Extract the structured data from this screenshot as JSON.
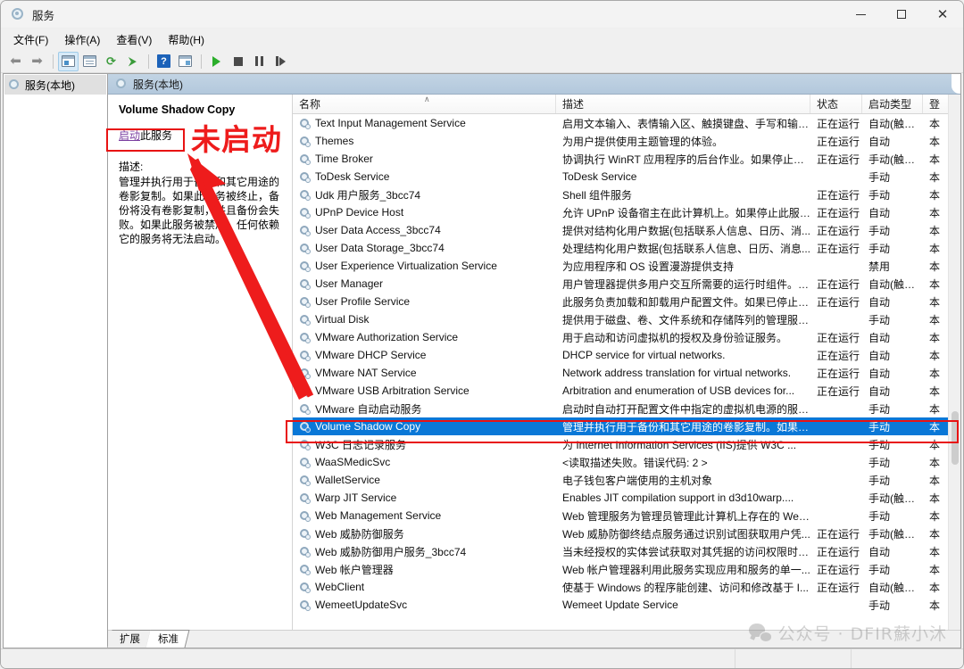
{
  "window": {
    "title": "服务",
    "icon": "services-gear-icon",
    "controls": {
      "minimize": "最小化",
      "maximize": "最大化",
      "close": "关闭"
    }
  },
  "menubar": [
    {
      "label": "文件(F)",
      "name": "menu-file"
    },
    {
      "label": "操作(A)",
      "name": "menu-action"
    },
    {
      "label": "查看(V)",
      "name": "menu-view"
    },
    {
      "label": "帮助(H)",
      "name": "menu-help"
    }
  ],
  "toolbar": [
    {
      "name": "back-button",
      "icon": "arrow-left-icon",
      "glyph": "⬅"
    },
    {
      "name": "forward-button",
      "icon": "arrow-right-icon",
      "glyph": "➡"
    },
    {
      "name": "show-hide-tree-button",
      "icon": "tree-pane-icon",
      "active": true
    },
    {
      "name": "properties-button",
      "icon": "document-properties-icon"
    },
    {
      "name": "refresh-button",
      "icon": "refresh-icon",
      "glyph": "⟳"
    },
    {
      "name": "export-list-button",
      "icon": "export-list-icon",
      "glyph": "⮞"
    },
    {
      "name": "help-button",
      "icon": "help-question-icon",
      "glyph": "?"
    },
    {
      "name": "show-action-pane-button",
      "icon": "action-pane-icon"
    },
    {
      "name": "start-service-button",
      "icon": "play-icon"
    },
    {
      "name": "stop-service-button",
      "icon": "stop-icon"
    },
    {
      "name": "pause-service-button",
      "icon": "pause-icon"
    },
    {
      "name": "restart-service-button",
      "icon": "restart-icon"
    }
  ],
  "tree": {
    "root": {
      "label": "服务(本地)",
      "icon": "services-gear-icon"
    }
  },
  "content_header": {
    "label": "服务(本地)",
    "icon": "services-gear-icon"
  },
  "detail": {
    "service_title": "Volume Shadow Copy",
    "action_link": "启动",
    "action_suffix": "此服务",
    "description_label": "描述:",
    "description_text": "管理并执行用于备份和其它用途的卷影复制。如果此服务被终止，备份将没有卷影复制，并且备份会失败。如果此服务被禁用，任何依赖它的服务将无法启动。"
  },
  "list": {
    "columns": [
      {
        "label": "名称",
        "name": "column-name",
        "sorted": true,
        "sort_glyph": "∧"
      },
      {
        "label": "描述",
        "name": "column-description"
      },
      {
        "label": "状态",
        "name": "column-status"
      },
      {
        "label": "启动类型",
        "name": "column-startup-type"
      },
      {
        "label": "登",
        "name": "column-logon-as"
      }
    ],
    "rows": [
      {
        "name": "Text Input Management Service",
        "desc": "启用文本输入、表情输入区、触摸键盘、手写和输入...",
        "status": "正在运行",
        "startup": "自动(触发...",
        "logon": "本",
        "selected": false
      },
      {
        "name": "Themes",
        "desc": "为用户提供使用主题管理的体验。",
        "status": "正在运行",
        "startup": "自动",
        "logon": "本",
        "selected": false
      },
      {
        "name": "Time Broker",
        "desc": "协调执行 WinRT 应用程序的后台作业。如果停止或...",
        "status": "正在运行",
        "startup": "手动(触发...",
        "logon": "本",
        "selected": false
      },
      {
        "name": "ToDesk Service",
        "desc": "ToDesk Service",
        "status": "",
        "startup": "手动",
        "logon": "本",
        "selected": false
      },
      {
        "name": "Udk 用户服务_3bcc74",
        "desc": "Shell 组件服务",
        "status": "正在运行",
        "startup": "手动",
        "logon": "本",
        "selected": false
      },
      {
        "name": "UPnP Device Host",
        "desc": "允许 UPnP 设备宿主在此计算机上。如果停止此服务...",
        "status": "正在运行",
        "startup": "自动",
        "logon": "本",
        "selected": false
      },
      {
        "name": "User Data Access_3bcc74",
        "desc": "提供对结构化用户数据(包括联系人信息、日历、消...",
        "status": "正在运行",
        "startup": "手动",
        "logon": "本",
        "selected": false
      },
      {
        "name": "User Data Storage_3bcc74",
        "desc": "处理结构化用户数据(包括联系人信息、日历、消息...",
        "status": "正在运行",
        "startup": "手动",
        "logon": "本",
        "selected": false
      },
      {
        "name": "User Experience Virtualization Service",
        "desc": "为应用程序和 OS 设置漫游提供支持",
        "status": "",
        "startup": "禁用",
        "logon": "本",
        "selected": false
      },
      {
        "name": "User Manager",
        "desc": "用户管理器提供多用户交互所需要的运行时组件。如...",
        "status": "正在运行",
        "startup": "自动(触发...",
        "logon": "本",
        "selected": false
      },
      {
        "name": "User Profile Service",
        "desc": "此服务负责加载和卸载用户配置文件。如果已停止或...",
        "status": "正在运行",
        "startup": "自动",
        "logon": "本",
        "selected": false
      },
      {
        "name": "Virtual Disk",
        "desc": "提供用于磁盘、卷、文件系统和存储阵列的管理服务...",
        "status": "",
        "startup": "手动",
        "logon": "本",
        "selected": false
      },
      {
        "name": "VMware Authorization Service",
        "desc": "用于启动和访问虚拟机的授权及身份验证服务。",
        "status": "正在运行",
        "startup": "自动",
        "logon": "本",
        "selected": false
      },
      {
        "name": "VMware DHCP Service",
        "desc": "DHCP service for virtual networks.",
        "status": "正在运行",
        "startup": "自动",
        "logon": "本",
        "selected": false
      },
      {
        "name": "VMware NAT Service",
        "desc": "Network address translation for virtual networks.",
        "status": "正在运行",
        "startup": "自动",
        "logon": "本",
        "selected": false
      },
      {
        "name": "VMware USB Arbitration Service",
        "desc": "Arbitration and enumeration of USB devices for...",
        "status": "正在运行",
        "startup": "自动",
        "logon": "本",
        "selected": false
      },
      {
        "name": "VMware 自动启动服务",
        "desc": "启动时自动打开配置文件中指定的虚拟机电源的服务...",
        "status": "",
        "startup": "手动",
        "logon": "本",
        "selected": false
      },
      {
        "name": "Volume Shadow Copy",
        "desc": "管理并执行用于备份和其它用途的卷影复制。如果此...",
        "status": "",
        "startup": "手动",
        "logon": "本",
        "selected": true
      },
      {
        "name": "W3C 日志记录服务",
        "desc": "为 Internet Information Services (IIS)提供 W3C ...",
        "status": "",
        "startup": "手动",
        "logon": "本",
        "selected": false
      },
      {
        "name": "WaaSMedicSvc",
        "desc": "<读取描述失败。错误代码: 2 >",
        "status": "",
        "startup": "手动",
        "logon": "本",
        "selected": false
      },
      {
        "name": "WalletService",
        "desc": "电子钱包客户端使用的主机对象",
        "status": "",
        "startup": "手动",
        "logon": "本",
        "selected": false
      },
      {
        "name": "Warp JIT Service",
        "desc": "Enables JIT compilation support in d3d10warp....",
        "status": "",
        "startup": "手动(触发...",
        "logon": "本",
        "selected": false
      },
      {
        "name": "Web Management Service",
        "desc": "Web 管理服务为管理员管理此计算机上存在的 Web...",
        "status": "",
        "startup": "手动",
        "logon": "本",
        "selected": false
      },
      {
        "name": "Web 威胁防御服务",
        "desc": "Web 威胁防御终结点服务通过识别试图获取用户凭...",
        "status": "正在运行",
        "startup": "手动(触发...",
        "logon": "本",
        "selected": false
      },
      {
        "name": "Web 威胁防御用户服务_3bcc74",
        "desc": "当未经授权的实体尝试获取对其凭据的访问权限时，...",
        "status": "正在运行",
        "startup": "自动",
        "logon": "本",
        "selected": false
      },
      {
        "name": "Web 帐户管理器",
        "desc": "Web 帐户管理器利用此服务实现应用和服务的单一...",
        "status": "正在运行",
        "startup": "手动",
        "logon": "本",
        "selected": false
      },
      {
        "name": "WebClient",
        "desc": "使基于 Windows 的程序能创建、访问和修改基于 I...",
        "status": "正在运行",
        "startup": "自动(触发...",
        "logon": "本",
        "selected": false
      },
      {
        "name": "WemeetUpdateSvc",
        "desc": "Wemeet Update Service",
        "status": "",
        "startup": "手动",
        "logon": "本",
        "selected": false
      }
    ]
  },
  "tabs": [
    {
      "label": "扩展",
      "name": "tab-extended",
      "active": false
    },
    {
      "label": "标准",
      "name": "tab-standard",
      "active": true
    }
  ],
  "statusbar": {
    "pane1": "",
    "pane2": "",
    "pane3": ""
  },
  "watermark": {
    "text": "公众号 · DFIR蘇小沐",
    "icon": "wechat-logo-icon"
  },
  "annotations": {
    "not_started_label": "未启动",
    "color": "#ee1c1c"
  },
  "colors": {
    "selection": "#0a78d7",
    "annotation_red": "#ee1c1c",
    "link_purple": "#7b3fa0",
    "header_blue": "#b3c8dc"
  }
}
